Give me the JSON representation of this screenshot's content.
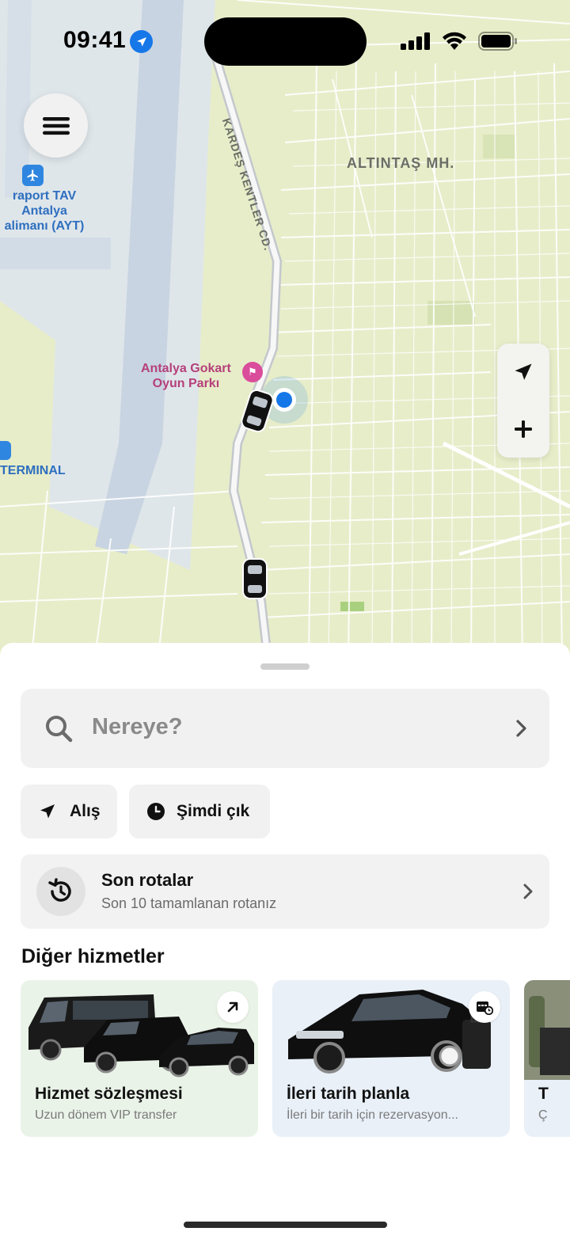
{
  "status_bar": {
    "time": "09:41",
    "icons": [
      "location-arrow-icon",
      "cellular-signal-icon",
      "wifi-icon",
      "battery-icon"
    ]
  },
  "map": {
    "district_label": "ALTINTAŞ MH.",
    "road_label": "KARDEŞ KENTLER CD.",
    "airport_label_line1": "raport TAV",
    "airport_label_line2": "Antalya",
    "airport_label_line3": "alimanı (AYT)",
    "terminal_label": "TERMINAL",
    "poi_line1": "Antalya Gokart",
    "poi_line2": "Oyun Parkı",
    "controls": [
      "recenter-arrow-icon",
      "zoom-in-plus-icon"
    ],
    "colors": {
      "land": "#e7edc9",
      "airport": "#dfe6ea",
      "runway": "#c5d3e3",
      "user_dot": "#1677e8"
    }
  },
  "search": {
    "placeholder": "Nereye?"
  },
  "chips": {
    "pickup": "Alış",
    "time": "Şimdi çık"
  },
  "recent_routes": {
    "title": "Son rotalar",
    "subtitle": "Son 10 tamamlanan rotanız"
  },
  "services": {
    "title": "Diğer hizmetler",
    "cards": [
      {
        "title": "Hizmet sözleşmesi",
        "subtitle": "Uzun dönem VIP transfer",
        "badge_icon": "arrow-up-right-icon",
        "bg": "#eaf3e8"
      },
      {
        "title": "İleri tarih planla",
        "subtitle": "İleri bir tarih için rezervasyon...",
        "badge_icon": "calendar-clock-icon",
        "bg": "#e9f0f8"
      },
      {
        "title": "T",
        "subtitle": "Ç",
        "bg": "#e9f0f8"
      }
    ]
  }
}
